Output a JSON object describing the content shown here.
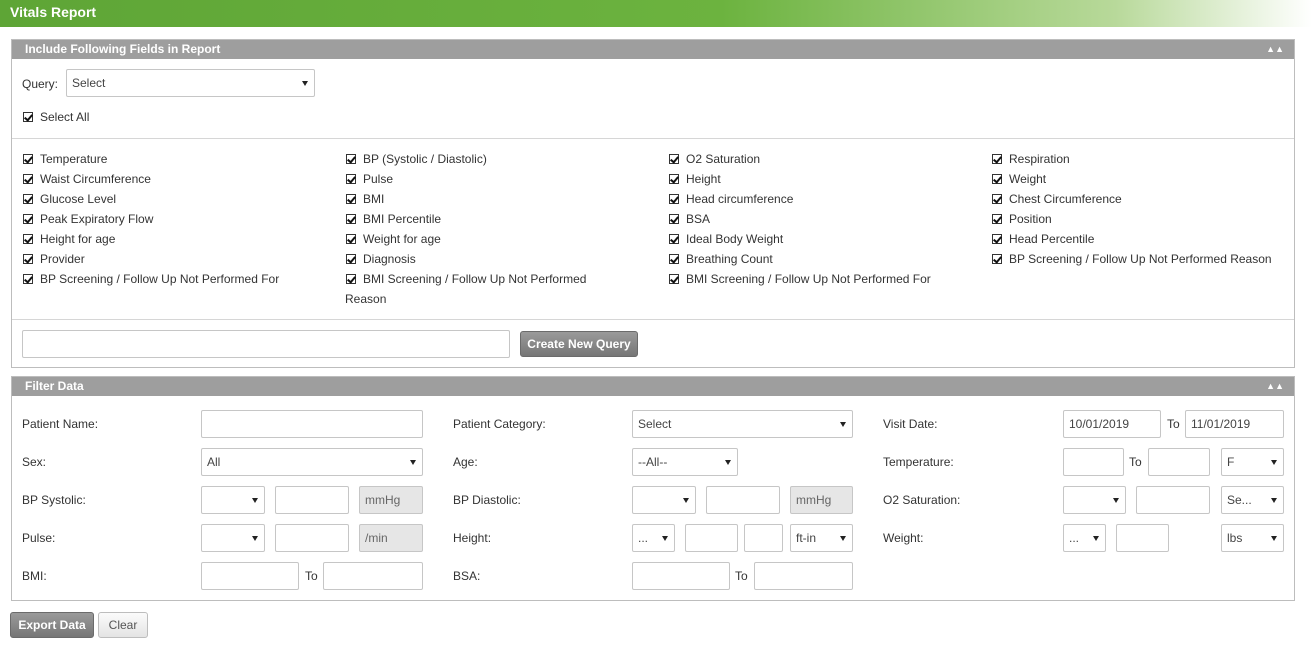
{
  "title": "Vitals Report",
  "fields_panel": {
    "header": "Include Following Fields in Report",
    "query_label": "Query:",
    "query_value": "Select",
    "select_all": "Select All",
    "col1": [
      "Temperature",
      "Waist Circumference",
      "Glucose Level",
      "Peak Expiratory Flow",
      "Height for age",
      "Provider",
      "BP Screening / Follow Up Not Performed For"
    ],
    "col2": [
      "BP (Systolic / Diastolic)",
      "Pulse",
      "BMI",
      "BMI Percentile",
      "Weight for age",
      "Diagnosis",
      "BMI Screening / Follow Up Not Performed",
      "Reason"
    ],
    "col3": [
      "O2 Saturation",
      "Height",
      "Head circumference",
      "BSA",
      "Ideal Body Weight",
      "Breathing Count",
      "BMI Screening / Follow Up Not Performed For"
    ],
    "col4": [
      "Respiration",
      "Weight",
      "Chest Circumference",
      "Position",
      "Head Percentile",
      "BP Screening / Follow Up Not Performed Reason"
    ],
    "new_query_value": "",
    "create_button": "Create New Query"
  },
  "filter_panel": {
    "header": "Filter Data",
    "patient_name_label": "Patient Name:",
    "patient_category_label": "Patient Category:",
    "patient_category_value": "Select",
    "visit_date_label": "Visit Date:",
    "visit_date_from": "10/01/2019",
    "visit_date_to": "11/01/2019",
    "to": "To",
    "sex_label": "Sex:",
    "sex_value": "All",
    "age_label": "Age:",
    "age_value": "--All--",
    "temperature_label": "Temperature:",
    "temperature_unit": "F",
    "bp_systolic_label": "BP Systolic:",
    "bp_diastolic_label": "BP Diastolic:",
    "mmhg": "mmHg",
    "o2_label": "O2 Saturation:",
    "o2_unit": "Se...",
    "pulse_label": "Pulse:",
    "pulse_unit": "/min",
    "height_label": "Height:",
    "height_op": "...",
    "height_unit": "ft-in",
    "weight_label": "Weight:",
    "weight_op": "...",
    "weight_unit": "lbs",
    "bmi_label": "BMI:",
    "bsa_label": "BSA:"
  },
  "buttons": {
    "export": "Export Data",
    "clear": "Clear"
  }
}
